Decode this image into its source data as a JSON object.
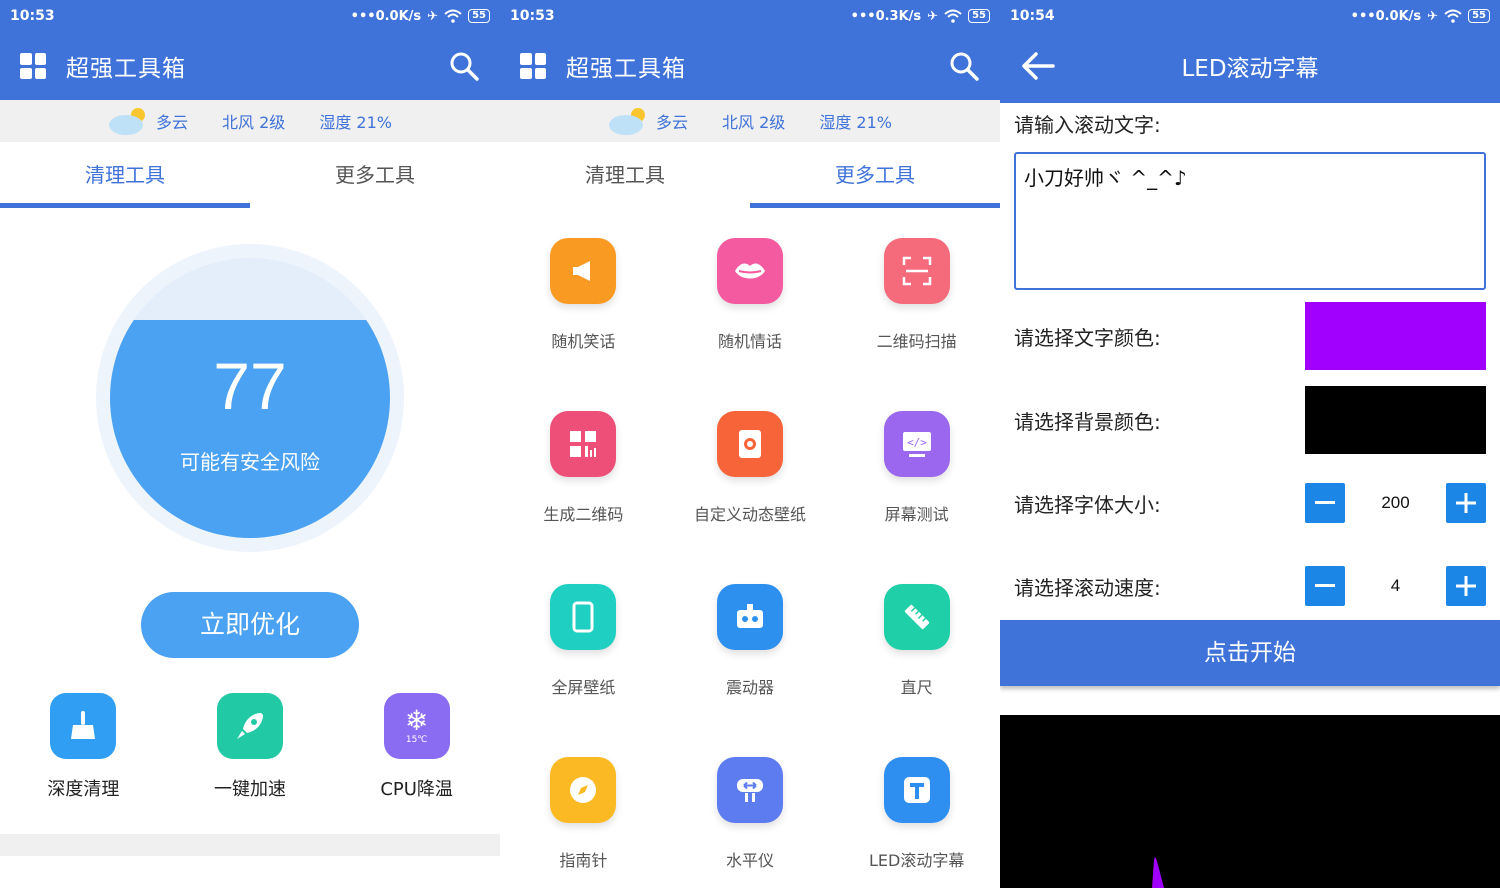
{
  "screen1": {
    "time": "10:53",
    "net": "0.0K/s",
    "battery": "55",
    "title": "超强工具箱",
    "weather": {
      "cond": "多云",
      "wind": "北风 2级",
      "humidity": "湿度 21%"
    },
    "tabs": [
      "清理工具",
      "更多工具"
    ],
    "gauge": {
      "score": "77",
      "level": 0.78,
      "text": "可能有安全风险"
    },
    "optimize_label": "立即优化",
    "quick": [
      {
        "label": "深度清理",
        "icon": "broom-icon",
        "color": "#2f9ef3"
      },
      {
        "label": "一键加速",
        "icon": "rocket-icon",
        "color": "#22c9a5"
      },
      {
        "label": "CPU降温",
        "icon": "snowflake-icon",
        "color": "#8a6cf2",
        "badge": "15℃"
      }
    ],
    "accent": "#3f73d9"
  },
  "screen2": {
    "time": "10:53",
    "net": "0.3K/s",
    "battery": "55",
    "title": "超强工具箱",
    "weather": {
      "cond": "多云",
      "wind": "北风 2级",
      "humidity": "湿度 21%"
    },
    "tabs": [
      "清理工具",
      "更多工具"
    ],
    "tools": [
      {
        "label": "随机笑话",
        "icon": "megaphone-icon",
        "color": "#f99a22"
      },
      {
        "label": "随机情话",
        "icon": "lips-icon",
        "color": "#f45aa0"
      },
      {
        "label": "二维码扫描",
        "icon": "scan-icon",
        "color": "#f56b7c"
      },
      {
        "label": "生成二维码",
        "icon": "qrcode-icon",
        "color": "#ee4f79"
      },
      {
        "label": "自定义动态壁纸",
        "icon": "wallpaper-icon",
        "color": "#f7643a"
      },
      {
        "label": "屏幕测试",
        "icon": "screen-test-icon",
        "color": "#9a67ee"
      },
      {
        "label": "全屏壁纸",
        "icon": "phone-icon",
        "color": "#1fcfc2"
      },
      {
        "label": "震动器",
        "icon": "vibrator-icon",
        "color": "#2e90ee"
      },
      {
        "label": "直尺",
        "icon": "ruler-icon",
        "color": "#1ecfa8"
      },
      {
        "label": "指南针",
        "icon": "compass-icon",
        "color": "#fbb923"
      },
      {
        "label": "水平仪",
        "icon": "level-icon",
        "color": "#5c7cf0"
      },
      {
        "label": "LED滚动字幕",
        "icon": "text-t-icon",
        "color": "#2f8ff0"
      }
    ]
  },
  "screen3": {
    "time": "10:54",
    "net": "0.0K/s",
    "battery": "55",
    "title": "LED滚动字幕",
    "input_label": "请输入滚动文字:",
    "input_value": "小刀好帅ヾ ^_^♪",
    "text_color_label": "请选择文字颜色:",
    "text_color": "#a100ff",
    "bg_color_label": "请选择背景颜色:",
    "bg_color": "#000000",
    "font_size_label": "请选择字体大小:",
    "font_size": "200",
    "speed_label": "请选择滚动速度:",
    "speed": "4",
    "start_label": "点击开始"
  }
}
